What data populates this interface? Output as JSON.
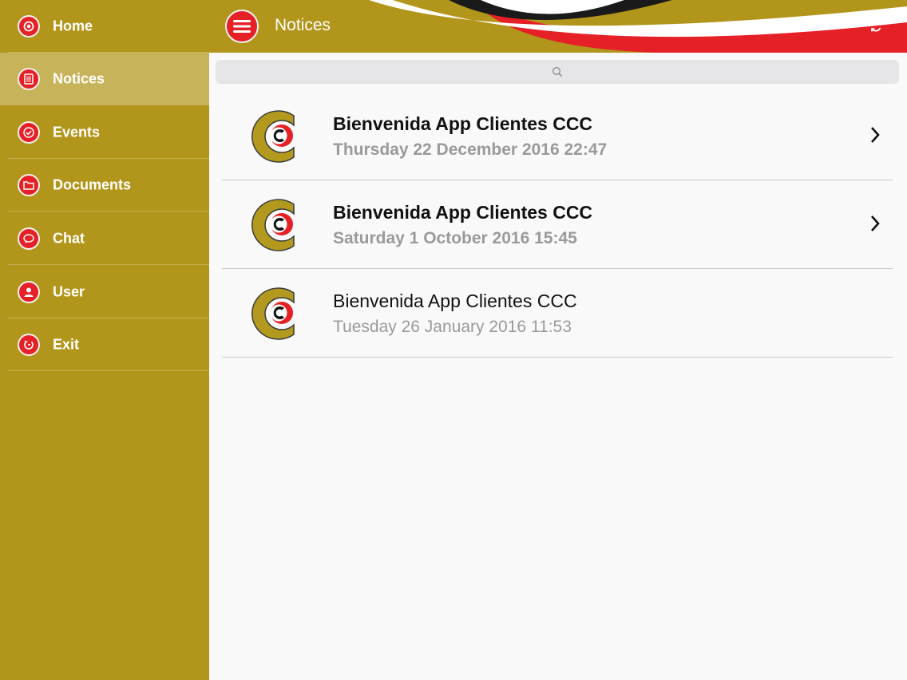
{
  "sidebar": {
    "items": [
      {
        "label": "Home",
        "icon": "home-icon"
      },
      {
        "label": "Notices",
        "icon": "notices-icon",
        "active": true
      },
      {
        "label": "Events",
        "icon": "events-icon"
      },
      {
        "label": "Documents",
        "icon": "documents-icon"
      },
      {
        "label": "Chat",
        "icon": "chat-icon"
      },
      {
        "label": "User",
        "icon": "user-icon"
      },
      {
        "label": "Exit",
        "icon": "exit-icon"
      }
    ]
  },
  "header": {
    "title": "Notices",
    "menu_icon": "hamburger-menu-icon",
    "refresh_icon": "refresh-icon"
  },
  "search": {
    "icon": "search-icon"
  },
  "notices": [
    {
      "title": "Bienvenida App Clientes CCC",
      "date": "Thursday 22 December 2016 22:47",
      "unread": true
    },
    {
      "title": "Bienvenida App Clientes CCC",
      "date": "Saturday 1 October 2016 15:45",
      "unread": true
    },
    {
      "title": "Bienvenida App Clientes CCC",
      "date": "Tuesday 26 January 2016 11:53",
      "unread": false
    }
  ],
  "colors": {
    "gold": "#b2961b",
    "red": "#e52027",
    "background": "#f9f9f9"
  }
}
